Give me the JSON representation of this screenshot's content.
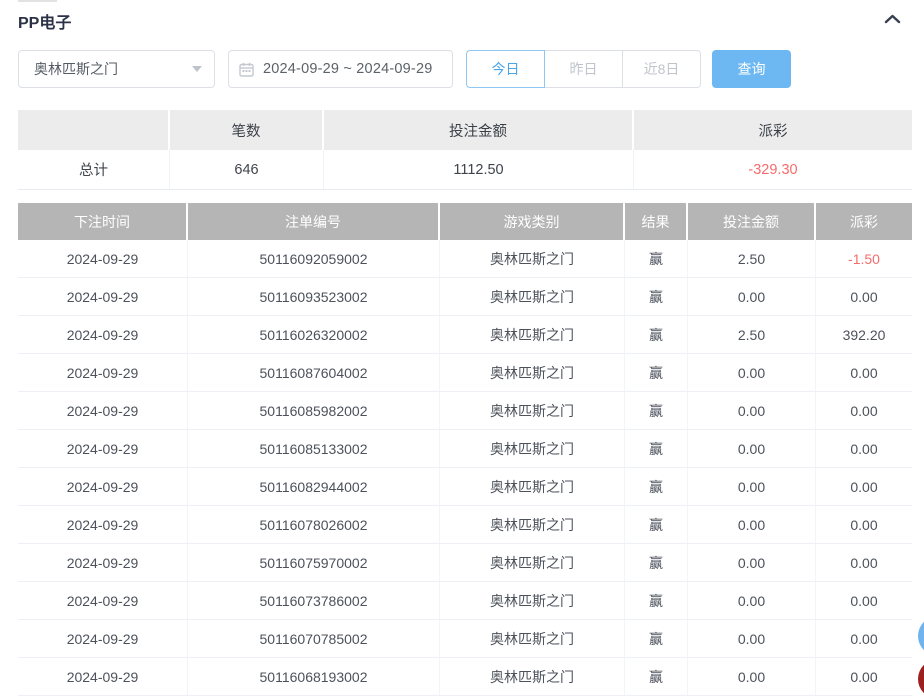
{
  "panel": {
    "title": "PP电子"
  },
  "filters": {
    "game_select": {
      "value": "奥林匹斯之门"
    },
    "date_range": {
      "value": "2024-09-29 ~ 2024-09-29"
    },
    "quick_buttons": [
      {
        "label": "今日",
        "active": true
      },
      {
        "label": "昨日",
        "active": false
      },
      {
        "label": "近8日",
        "active": false
      }
    ],
    "search_label": "查询"
  },
  "summary_table": {
    "headers": [
      "",
      "笔数",
      "投注金额",
      "派彩"
    ],
    "total_label": "总计",
    "count": "646",
    "bet_amount": "1112.50",
    "payout": "-329.30"
  },
  "records_table": {
    "headers": [
      "下注时间",
      "注单编号",
      "游戏类别",
      "结果",
      "投注金额",
      "派彩"
    ],
    "column_names": [
      "bet-time-cell",
      "order-number-cell",
      "game-category-cell",
      "result-cell",
      "bet-amount-cell",
      "payout-cell"
    ],
    "rows": [
      [
        "2024-09-29",
        "50116092059002",
        "奥林匹斯之门",
        "赢",
        "2.50",
        "-1.50"
      ],
      [
        "2024-09-29",
        "50116093523002",
        "奥林匹斯之门",
        "赢",
        "0.00",
        "0.00"
      ],
      [
        "2024-09-29",
        "50116026320002",
        "奥林匹斯之门",
        "赢",
        "2.50",
        "392.20"
      ],
      [
        "2024-09-29",
        "50116087604002",
        "奥林匹斯之门",
        "赢",
        "0.00",
        "0.00"
      ],
      [
        "2024-09-29",
        "50116085982002",
        "奥林匹斯之门",
        "赢",
        "0.00",
        "0.00"
      ],
      [
        "2024-09-29",
        "50116085133002",
        "奥林匹斯之门",
        "赢",
        "0.00",
        "0.00"
      ],
      [
        "2024-09-29",
        "50116082944002",
        "奥林匹斯之门",
        "赢",
        "0.00",
        "0.00"
      ],
      [
        "2024-09-29",
        "50116078026002",
        "奥林匹斯之门",
        "赢",
        "0.00",
        "0.00"
      ],
      [
        "2024-09-29",
        "50116075970002",
        "奥林匹斯之门",
        "赢",
        "0.00",
        "0.00"
      ],
      [
        "2024-09-29",
        "50116073786002",
        "奥林匹斯之门",
        "赢",
        "0.00",
        "0.00"
      ],
      [
        "2024-09-29",
        "50116070785002",
        "奥林匹斯之门",
        "赢",
        "0.00",
        "0.00"
      ],
      [
        "2024-09-29",
        "50116068193002",
        "奥林匹斯之门",
        "赢",
        "0.00",
        "0.00"
      ]
    ]
  },
  "colors": {
    "accent_blue": "#6db8f2",
    "active_tab_blue": "#4ba4e8",
    "negative_red": "#f56c6c",
    "table_header_gray": "#b5b5b5",
    "summary_header_gray": "#ececec",
    "fab_blue": "#6fb3ef",
    "fab_red": "#9c2020"
  }
}
